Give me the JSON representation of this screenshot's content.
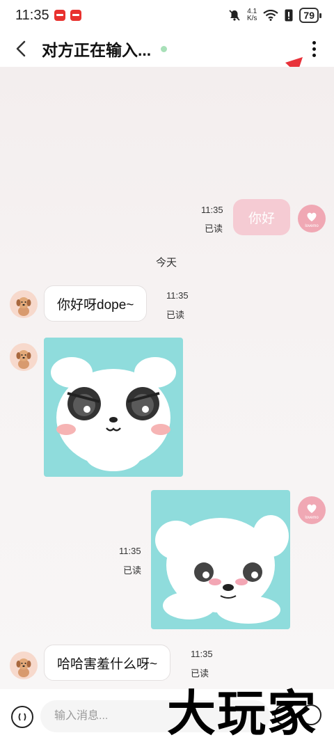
{
  "status_bar": {
    "time": "11:35",
    "net_speed_value": "4.1",
    "net_speed_unit": "K/s",
    "battery": "79"
  },
  "header": {
    "title": "对方正在输入...",
    "status_color": "#a8e0b8"
  },
  "messages": [
    {
      "side": "right",
      "type": "text",
      "text": "你好",
      "time": "11:35",
      "status": "已读",
      "avatar_text": "lovemo"
    },
    {
      "side": "divider",
      "text": "今天"
    },
    {
      "side": "left",
      "type": "text",
      "text": "你好呀dope~",
      "time": "11:35",
      "status": "已读"
    },
    {
      "side": "left",
      "type": "sticker",
      "sticker": "angry-white-puppy"
    },
    {
      "side": "right",
      "type": "sticker",
      "sticker": "shy-white-puppy",
      "time": "11:35",
      "status": "已读",
      "avatar_text": "lovemo"
    },
    {
      "side": "left",
      "type": "text",
      "text": "哈哈害羞什么呀~",
      "time": "11:35",
      "status": "已读"
    }
  ],
  "input_bar": {
    "placeholder": "输入消息..."
  },
  "watermark": "大玩家",
  "colors": {
    "accent_pink": "#f5cbd3",
    "sticker_bg": "#8fdcdc",
    "annotation_arrow": "#e8323a"
  }
}
